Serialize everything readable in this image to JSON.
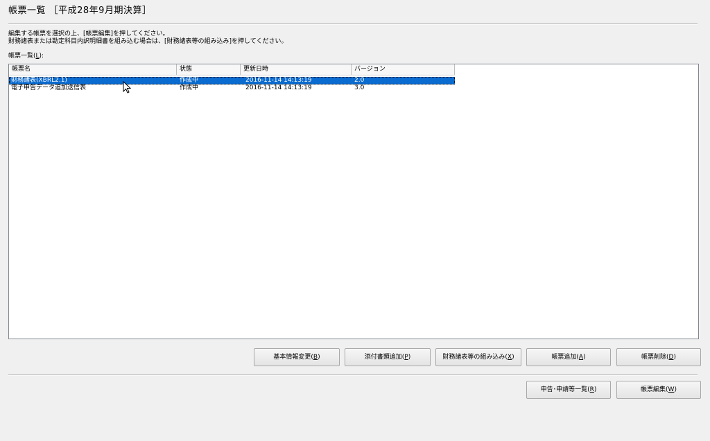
{
  "window": {
    "title": "帳票一覧 ［平成28年9月期決算］"
  },
  "instructions": {
    "line1": "編集する帳票を選択の上、[帳票編集]を押してください。",
    "line2": "財務諸表または勘定科目内訳明細書を組み込む場合は、[財務諸表等の組み込み]を押してください。"
  },
  "list": {
    "label": "帳票一覧(",
    "label_accel": "L",
    "label_suffix": "):",
    "columns": [
      "帳票名",
      "状態",
      "更新日時",
      "バージョン"
    ],
    "rows": [
      {
        "name": "財務諸表(XBRL2.1)",
        "status": "作成中",
        "updated": "2016-11-14 14:13:19",
        "version": "2.0",
        "selected": true
      },
      {
        "name": "電子申告データ追加送信表",
        "status": "作成中",
        "updated": "2016-11-14 14:13:19",
        "version": "3.0",
        "selected": false
      }
    ]
  },
  "buttons": {
    "basic_info": {
      "label": "基本情報変更(",
      "accel": "B",
      "suffix": ")"
    },
    "add_attachment": {
      "label": "添付書類追加(",
      "accel": "P",
      "suffix": ")"
    },
    "import_fs": {
      "label": "財務諸表等の組み込み(",
      "accel": "X",
      "suffix": ")"
    },
    "add_form": {
      "label": "帳票追加(",
      "accel": "A",
      "suffix": ")"
    },
    "delete_form": {
      "label": "帳票削除(",
      "accel": "D",
      "suffix": ")"
    },
    "applications": {
      "label": "申告･申請等一覧(",
      "accel": "R",
      "suffix": ")"
    },
    "edit_form": {
      "label": "帳票編集(",
      "accel": "W",
      "suffix": ")"
    }
  },
  "colors": {
    "selection": "#0a6bd0",
    "background": "#f0f0f0"
  },
  "icons": {
    "cursor": "mouse-pointer-icon"
  }
}
